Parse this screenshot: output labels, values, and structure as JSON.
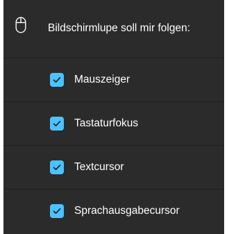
{
  "header": {
    "icon": "mouse-icon",
    "label": "Bildschirmlupe soll mir folgen:"
  },
  "options": [
    {
      "label": "Mauszeiger",
      "checked": true
    },
    {
      "label": "Tastaturfokus",
      "checked": true
    },
    {
      "label": "Textcursor",
      "checked": true
    },
    {
      "label": "Sprachausgabecursor",
      "checked": true
    }
  ],
  "colors": {
    "panel_background": "#2b2b2b",
    "divider": "#1f1f1f",
    "checkbox_accent": "#4cc2ff",
    "checkmark": "#1a1a1a",
    "text": "#ffffff"
  }
}
